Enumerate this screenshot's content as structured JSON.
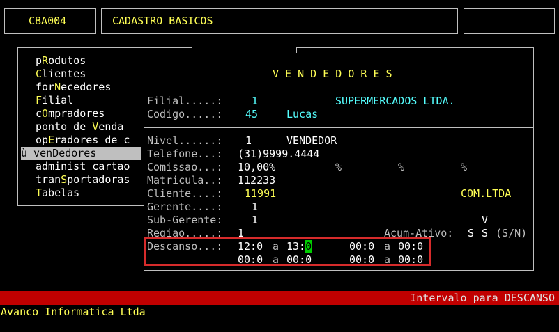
{
  "header": {
    "code": "CBA004",
    "title": "CADASTRO BASICOS"
  },
  "menu": {
    "items": [
      {
        "pre": "p",
        "key": "R",
        "post": "odutos"
      },
      {
        "pre": "",
        "key": "C",
        "post": "lientes"
      },
      {
        "pre": "for",
        "key": "N",
        "post": "ecedores"
      },
      {
        "pre": "",
        "key": "F",
        "post": "ilial"
      },
      {
        "pre": "c",
        "key": "O",
        "post": "mpradores"
      },
      {
        "pre": "ponto de ",
        "key": "V",
        "post": "enda"
      },
      {
        "pre": "op",
        "key": "E",
        "post": "radores de c"
      },
      {
        "pre": "ù ven",
        "key": "D",
        "post": "edores"
      },
      {
        "pre": "administ cartao",
        "key": "",
        "post": ""
      },
      {
        "pre": "tran",
        "key": "S",
        "post": "portadoras"
      },
      {
        "pre": "",
        "key": "T",
        "post": "abelas"
      }
    ],
    "selected_index": 7
  },
  "form": {
    "title": "V E N D E D O R E S",
    "filial_label": "Filial.....:",
    "filial_value": "1",
    "filial_name": "SUPERMERCADOS LTDA.",
    "codigo_label": "Codigo.....:",
    "codigo_value": "45",
    "codigo_name": "Lucas",
    "nivel_label": "Nivel......:",
    "nivel_value": "1",
    "nivel_name": "VENDEDOR",
    "telefone_label": "Telefone...:",
    "telefone_value": "(31)9999.4444",
    "comissao_label": "Comissao...:",
    "comissao_value": "10,00%",
    "comissao_pct2": "%",
    "comissao_pct3": "%",
    "comissao_pct4": "%",
    "matricula_label": "Matricula..:",
    "matricula_value": "112233",
    "cliente_label": "Cliente....:",
    "cliente_value": "11991",
    "cliente_name": "COM.LTDA",
    "gerente_label": "Gerente....:",
    "gerente_value": "1",
    "subgerente_label": "Sub-Gerente:",
    "subgerente_value": "1",
    "subgerente_flag": "V",
    "regiao_label": "Regiao.....:",
    "regiao_value": "1",
    "acum_label": "Acum-Ativo:",
    "acum_value1": "S",
    "acum_value2": "S",
    "acum_hint": "(S/N)",
    "descanso_label": "Descanso...:",
    "descanso": {
      "r1_start": "12:0",
      "r1_a": "a",
      "r1_end_prefix": "13:",
      "r1_end_cursor": "0",
      "r1b_start": "00:0",
      "r1b_a": "a",
      "r1b_end": "00:0",
      "r2_start": "00:0",
      "r2_a": "a",
      "r2_end": "00:0",
      "r2b_start": "00:0",
      "r2b_a": "a",
      "r2b_end": "00:0"
    }
  },
  "status": {
    "message": "Intervalo para DESCANSO",
    "bar_color": "#c00000"
  },
  "footer": {
    "company": "Avanco Informatica Ltda"
  }
}
